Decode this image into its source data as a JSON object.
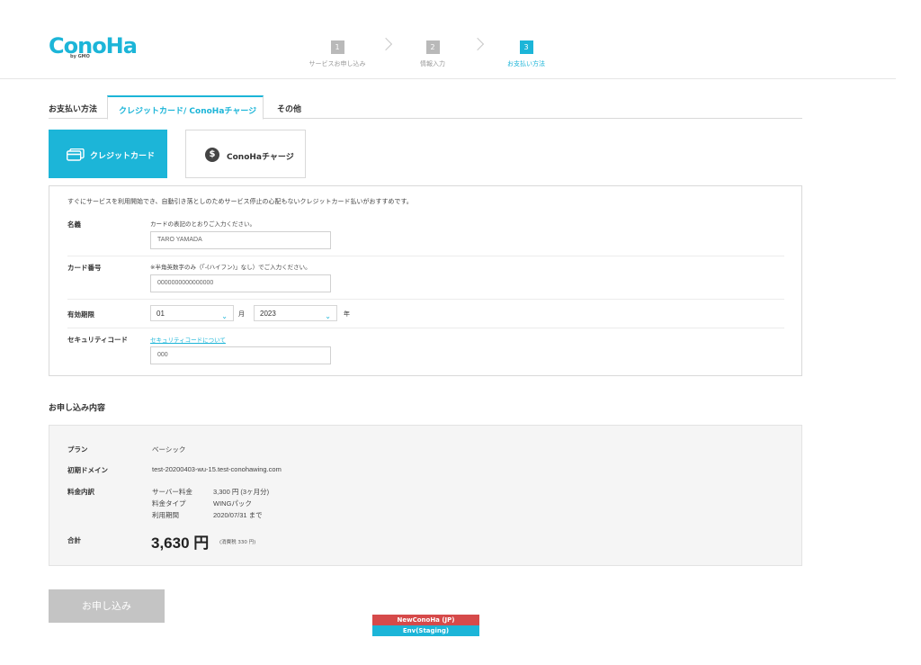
{
  "brand": {
    "logo": "ConoHa",
    "logo_sub": "by GMO",
    "accent": "#1cb5d8"
  },
  "steps": [
    {
      "num": "1",
      "label": "サービスお申し込み",
      "active": false
    },
    {
      "num": "2",
      "label": "情報入力",
      "active": false
    },
    {
      "num": "3",
      "label": "お支払い方法",
      "active": true
    }
  ],
  "payment": {
    "title": "お支払い方法",
    "tabs": [
      {
        "label": "クレジットカード/ ConoHaチャージ",
        "active": true
      },
      {
        "label": "その他",
        "active": false
      }
    ],
    "methods": [
      {
        "label": "クレジットカード",
        "icon": "credit-card-icon",
        "selected": true
      },
      {
        "label": "ConoHaチャージ",
        "icon": "dollar-coin-icon",
        "selected": false
      }
    ]
  },
  "card_form": {
    "intro": "すぐにサービスを利用開始でき、自動引き落としのためサービス停止の心配もないクレジットカード払いがおすすめです。",
    "name": {
      "label": "名義",
      "hint": "カードの表記のとおりご入力ください。",
      "placeholder": "TARO YAMADA"
    },
    "number": {
      "label": "カード番号",
      "hint": "※半角英数字のみ（「-(ハイフン)」なし）でご入力ください。",
      "placeholder": "0000000000000000"
    },
    "expiry": {
      "label": "有効期限",
      "month": "01",
      "month_unit": "月",
      "year": "2023",
      "year_unit": "年"
    },
    "security": {
      "label": "セキュリティコード",
      "link": "セキュリティコードについて",
      "placeholder": "000"
    }
  },
  "summary": {
    "title": "お申し込み内容",
    "plan_label": "プラン",
    "plan_value": "ベーシック",
    "domain_label": "初期ドメイン",
    "domain_value": "test-20200403-wu-15.test-conohawing.com",
    "breakdown_label": "料金内訳",
    "breakdown": [
      {
        "k": "サーバー料金",
        "v": "3,300 円 (3ヶ月分)"
      },
      {
        "k": "料金タイプ",
        "v": "WINGパック"
      },
      {
        "k": "利用期間",
        "v": "2020/07/31 まで"
      }
    ],
    "total_label": "合計",
    "total_amount": "3,630 円",
    "total_tax": "(消費税 330 円)"
  },
  "submit_label": "お申し込み",
  "env": {
    "line1": "NewConoHa (JP)",
    "line2": "Env(Staging)"
  }
}
